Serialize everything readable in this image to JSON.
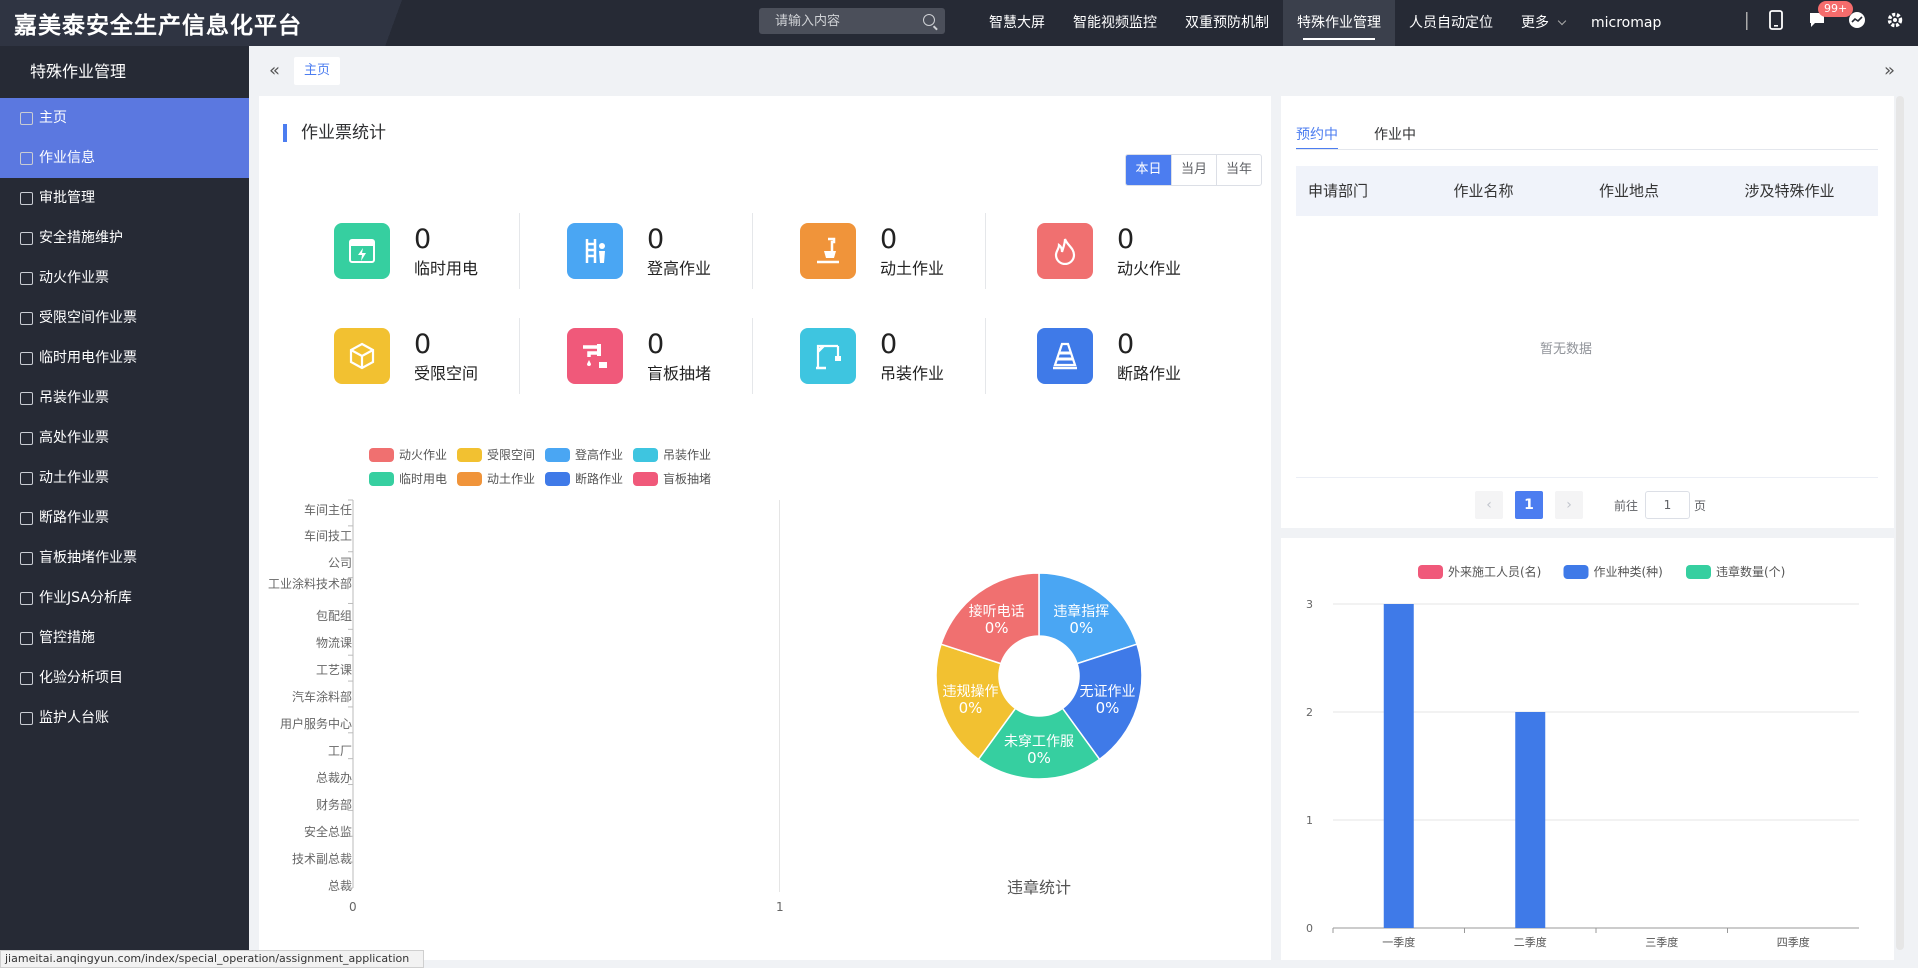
{
  "header": {
    "title": "嘉美泰安全生产信息化平台",
    "search_placeholder": "请输入内容",
    "nav": [
      "智慧大屏",
      "智能视频监控",
      "双重预防机制",
      "特殊作业管理",
      "人员自动定位"
    ],
    "more": "更多",
    "user": "micromap",
    "badge": "99+"
  },
  "sidebar": {
    "title": "特殊作业管理",
    "items": [
      "主页",
      "作业信息",
      "审批管理",
      "安全措施维护",
      "动火作业票",
      "受限空间作业票",
      "临时用电作业票",
      "吊装作业票",
      "高处作业票",
      "动土作业票",
      "断路作业票",
      "盲板抽堵作业票",
      "作业JSA分析库",
      "管控措施",
      "化验分析项目",
      "监护人台账"
    ]
  },
  "breadcrumb": {
    "home": "主页"
  },
  "ticket_stats": {
    "title": "作业票统计",
    "periods": [
      "本日",
      "当月",
      "当年"
    ],
    "items": [
      {
        "label": "临时用电",
        "value": "0",
        "color": "#36cfa0",
        "icon": "power-box-icon"
      },
      {
        "label": "登高作业",
        "value": "0",
        "color": "#4aa6f3",
        "icon": "ladder-icon"
      },
      {
        "label": "动土作业",
        "value": "0",
        "color": "#f0943a",
        "icon": "shovel-icon"
      },
      {
        "label": "动火作业",
        "value": "0",
        "color": "#f07070",
        "icon": "flame-icon"
      },
      {
        "label": "受限空间",
        "value": "0",
        "color": "#f2c131",
        "icon": "box-icon"
      },
      {
        "label": "盲板抽堵",
        "value": "0",
        "color": "#f0597a",
        "icon": "pipe-icon"
      },
      {
        "label": "吊装作业",
        "value": "0",
        "color": "#3ec5e0",
        "icon": "crane-icon"
      },
      {
        "label": "断路作业",
        "value": "0",
        "color": "#3f7ae8",
        "icon": "cone-icon"
      }
    ]
  },
  "legend": [
    {
      "name": "动火作业",
      "color": "#f07070"
    },
    {
      "name": "受限空间",
      "color": "#f2c131"
    },
    {
      "name": "登高作业",
      "color": "#4aa6f3"
    },
    {
      "name": "吊装作业",
      "color": "#3ec5e0"
    },
    {
      "name": "临时用电",
      "color": "#36cfa0"
    },
    {
      "name": "动土作业",
      "color": "#f0943a"
    },
    {
      "name": "断路作业",
      "color": "#3f7ae8"
    },
    {
      "name": "盲板抽堵",
      "color": "#f0597a"
    }
  ],
  "pie_title": "违章统计",
  "right_panel": {
    "tabs": [
      "预约中",
      "作业中"
    ],
    "columns": [
      "申请部门",
      "作业名称",
      "作业地点",
      "涉及特殊作业"
    ],
    "empty": "暂无数据",
    "page": "1",
    "goto_prefix": "前往",
    "goto_value": "1",
    "goto_suffix": "页"
  },
  "status_url": "jiameitai.anqingyun.com/index/special_operation/assignment_application",
  "chart_data": [
    {
      "type": "bar",
      "orientation": "horizontal",
      "categories": [
        "车间主任",
        "车间技工",
        "公司",
        "工业涂料技术部",
        "包配组",
        "物流课",
        "工艺课",
        "汽车涂料部",
        "用户服务中心",
        "工厂",
        "总裁办",
        "财务部",
        "安全总监",
        "技术副总裁",
        "总裁"
      ],
      "series": [],
      "xlim": [
        0,
        1
      ],
      "x_ticks": [
        "0",
        "1"
      ]
    },
    {
      "type": "pie",
      "title": "违章统计",
      "slices": [
        {
          "label": "违章指挥",
          "percent": "0%",
          "color": "#4aa6f3"
        },
        {
          "label": "无证作业",
          "percent": "0%",
          "color": "#3f7ae8"
        },
        {
          "label": "未穿工作服",
          "percent": "0%",
          "color": "#36cfa0"
        },
        {
          "label": "违规操作",
          "percent": "0%",
          "color": "#f2c131"
        },
        {
          "label": "接听电话",
          "percent": "0%",
          "color": "#f07070"
        }
      ]
    },
    {
      "type": "bar",
      "categories": [
        "一季度",
        "二季度",
        "三季度",
        "四季度"
      ],
      "series": [
        {
          "name": "外来施工人员(名)",
          "color": "#f0597a",
          "values": [
            0,
            0,
            0,
            0
          ]
        },
        {
          "name": "作业种类(种)",
          "color": "#3f7ae8",
          "values": [
            3,
            2,
            0,
            0
          ]
        },
        {
          "name": "违章数量(个)",
          "color": "#36cfa0",
          "values": [
            0,
            0,
            0,
            0
          ]
        }
      ],
      "ylim": [
        0,
        3
      ],
      "y_ticks": [
        "0",
        "1",
        "2",
        "3"
      ]
    }
  ]
}
